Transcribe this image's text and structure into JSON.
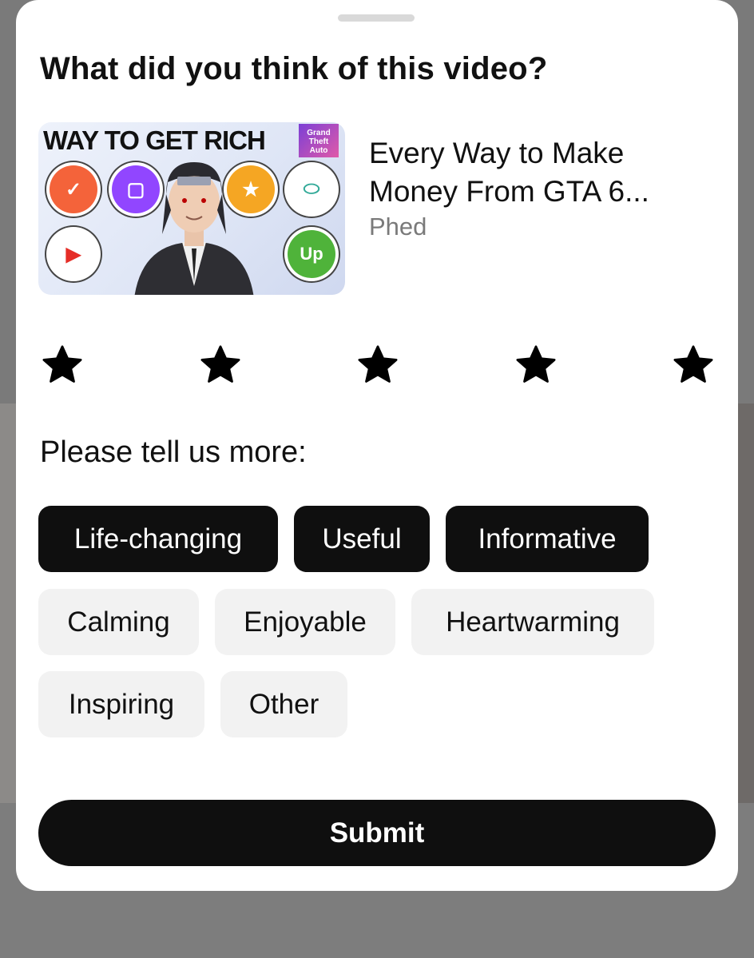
{
  "sheet": {
    "title": "What did you think of this video?",
    "video": {
      "thumbnail_text": "WAY TO GET RICH",
      "thumbnail_badge": "Grand Theft Auto VI",
      "title": "Every Way to Make Money From GTA 6...",
      "channel": "Phed"
    },
    "rating": {
      "max": 5,
      "icon": "star-icon"
    },
    "prompt": "Please tell us more:",
    "chips": [
      {
        "label": "Life-changing",
        "selected": true
      },
      {
        "label": "Useful",
        "selected": true
      },
      {
        "label": "Informative",
        "selected": true
      },
      {
        "label": "Calming",
        "selected": false
      },
      {
        "label": "Enjoyable",
        "selected": false
      },
      {
        "label": "Heartwarming",
        "selected": false
      },
      {
        "label": "Inspiring",
        "selected": false
      },
      {
        "label": "Other",
        "selected": false
      }
    ],
    "submit_label": "Submit"
  },
  "colors": {
    "selected_chip": "#0f0f0f",
    "unselected_chip": "#f2f2f2",
    "submit": "#0f0f0f"
  }
}
